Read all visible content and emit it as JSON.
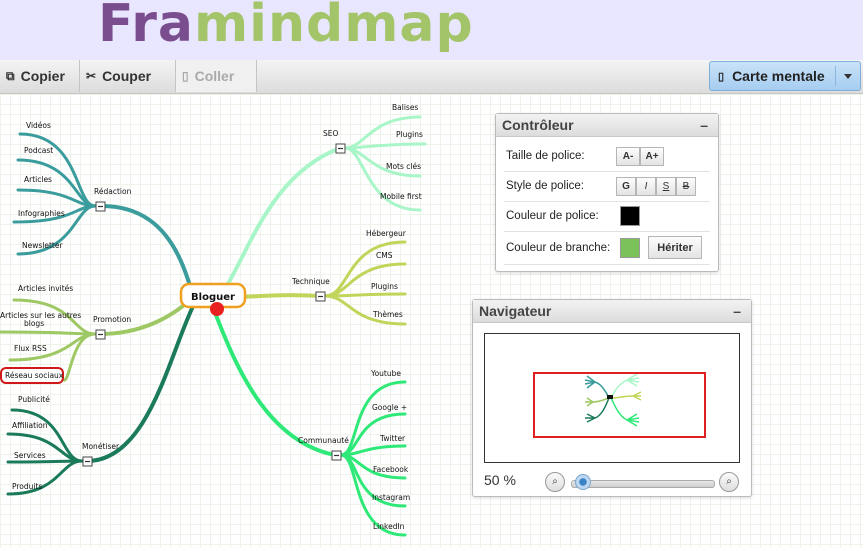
{
  "app": {
    "logo_part1": "Fra",
    "logo_part2": "mindmap"
  },
  "toolbar": {
    "copy": "Copier",
    "cut": "Couper",
    "paste": "Coller",
    "map_mode": "Carte mentale"
  },
  "map": {
    "central": "Bloguer",
    "branches": {
      "seo": {
        "label": "SEO",
        "children": [
          "Balises",
          "Plugins",
          "Mots clés",
          "Mobile first"
        ]
      },
      "technique": {
        "label": "Technique",
        "children": [
          "Hébergeur",
          "CMS",
          "Plugins",
          "Thèmes"
        ]
      },
      "communaute": {
        "label": "Communauté",
        "children": [
          "Youtube",
          "Google +",
          "Twitter",
          "Facebook",
          "Instagram",
          "LinkedIn"
        ]
      },
      "redaction": {
        "label": "Rédaction",
        "children": [
          "Vidéos",
          "Podcast",
          "Articles",
          "Infographies",
          "Newsletter"
        ]
      },
      "promotion": {
        "label": "Promotion",
        "children": [
          "Articles invités",
          "Articles sur les autres",
          "blogs",
          "Flux RSS",
          "Réseau sociaux"
        ]
      },
      "monetiser": {
        "label": "Monétiser",
        "children": [
          "Publicité",
          "Affiliation",
          "Services",
          "Produits"
        ]
      }
    },
    "colors": {
      "seo": "#a8f5c8",
      "technique": "#c2d45a",
      "communaute": "#2ee878",
      "redaction": "#3a9c9c",
      "promotion": "#9ec864",
      "monetiser": "#1a7a5a",
      "central_border": "#f0a020",
      "central_dot": "#e82020"
    }
  },
  "controller": {
    "title": "Contrôleur",
    "font_size_label": "Taille de police:",
    "font_minus": "A-",
    "font_plus": "A+",
    "font_style_label": "Style de police:",
    "style_bold": "G",
    "style_italic": "I",
    "style_underline": "S",
    "style_strike": "B",
    "font_color_label": "Couleur de police:",
    "branch_color_label": "Couleur de branche:",
    "inherit": "Hériter",
    "font_color": "#000000",
    "branch_color": "#7cc25a"
  },
  "navigator": {
    "title": "Navigateur",
    "zoom": "50 %"
  }
}
